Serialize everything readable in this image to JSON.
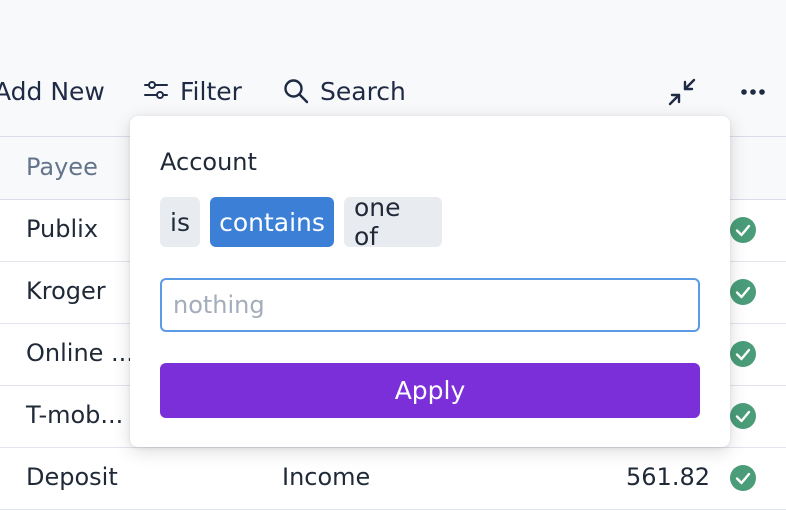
{
  "toolbar": {
    "add_new_label": "Add New",
    "filter_label": "Filter",
    "search_label": "Search",
    "collapse_icon": "collapse-icon",
    "more_icon": "more-icon"
  },
  "table": {
    "header": {
      "payee": "Payee"
    },
    "rows": [
      {
        "payee": "Publix",
        "category": "",
        "amount": "",
        "cleared": true
      },
      {
        "payee": "Kroger",
        "category": "",
        "amount": "",
        "cleared": true
      },
      {
        "payee": "Online ...",
        "category": "",
        "amount": "",
        "cleared": true
      },
      {
        "payee": "T-mob...",
        "category": "",
        "amount": "",
        "cleared": true
      },
      {
        "payee": "Deposit",
        "category": "Income",
        "amount": "561.82",
        "cleared": true
      }
    ]
  },
  "filter_popover": {
    "field_label": "Account",
    "operators": [
      "is",
      "contains",
      "one of"
    ],
    "selected_operator": "contains",
    "input_value": "",
    "input_placeholder": "nothing",
    "apply_label": "Apply"
  },
  "colors": {
    "accent_blue": "#3b7fd6",
    "apply_purple": "#7b2fd9",
    "cleared_green": "#4a9d78"
  }
}
